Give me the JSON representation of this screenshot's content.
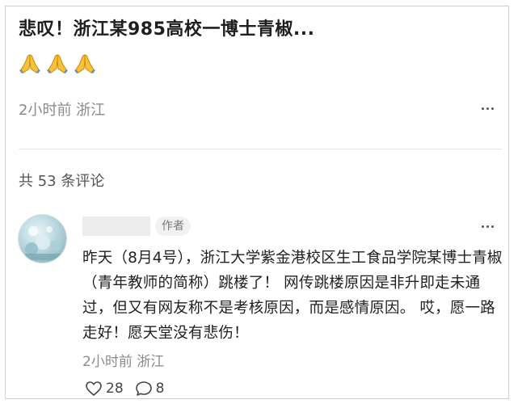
{
  "post": {
    "title": "悲叹！浙江某985高校一博士青椒...",
    "emojis": [
      "folded-hands",
      "folded-hands",
      "folded-hands"
    ],
    "meta": "2小时前 浙江"
  },
  "comments_section": {
    "count_label": "共 53 条评论"
  },
  "comment": {
    "author_badge": "作者",
    "text": "昨天（8月4号），浙江大学紫金港校区生工食品学院某博士青椒（青年教师的简称）跳楼了！ 网传跳楼原因是非升即走未通过，但又有网友称不是考核原因，而是感情原因。 哎，愿一路走好！愿天堂没有悲伤！",
    "meta": "2小时前 浙江",
    "likes": "28",
    "replies": "8"
  },
  "colors": {
    "text_primary": "#1f1f1f",
    "text_secondary": "#8a8a8a",
    "border": "#cfcfcf",
    "emoji_yellow": "#f4b400"
  }
}
